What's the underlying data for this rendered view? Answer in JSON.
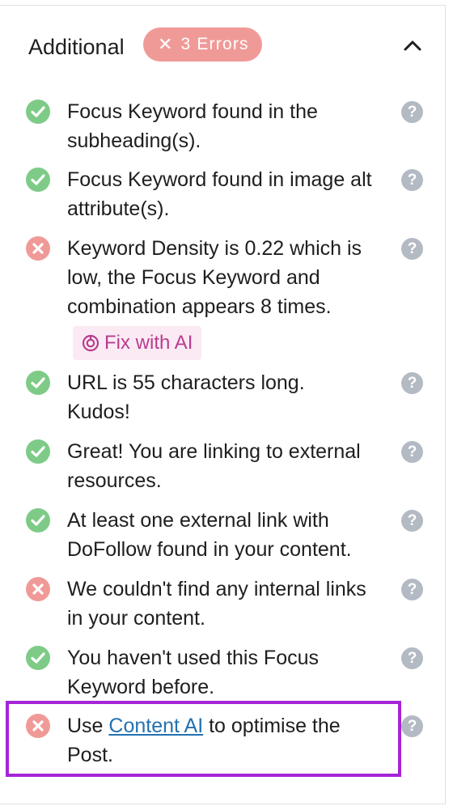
{
  "section": {
    "title": "Additional",
    "badge_icon": "close-icon",
    "badge_label": "3 Errors"
  },
  "colors": {
    "pass": "#7ecb87",
    "fail": "#f09a98",
    "badge": "#f09a98",
    "help": "#b3bac4",
    "ai_button_bg": "#fbeaf3",
    "ai_button_text": "#b73c90",
    "link": "#2271b1",
    "highlight": "#a524d8"
  },
  "items": [
    {
      "status": "pass",
      "text": "Focus Keyword found in the subheading(s)."
    },
    {
      "status": "pass",
      "text": "Focus Keyword found in image alt attribute(s)."
    },
    {
      "status": "fail",
      "text": "Keyword Density is 0.22 which is low, the Focus Keyword and combination appears 8 times.",
      "action_label": "Fix with AI"
    },
    {
      "status": "pass",
      "text": "URL is 55 characters long. Kudos!"
    },
    {
      "status": "pass",
      "text": "Great! You are linking to external resources."
    },
    {
      "status": "pass",
      "text": "At least one external link with DoFollow found in your content."
    },
    {
      "status": "fail",
      "text": "We couldn't find any internal links in your content."
    },
    {
      "status": "pass",
      "text": "You haven't used this Focus Keyword before."
    },
    {
      "status": "fail",
      "text_before": "Use ",
      "link_text": "Content AI",
      "text_after": " to optimise the Post."
    }
  ],
  "help_glyph": "?"
}
